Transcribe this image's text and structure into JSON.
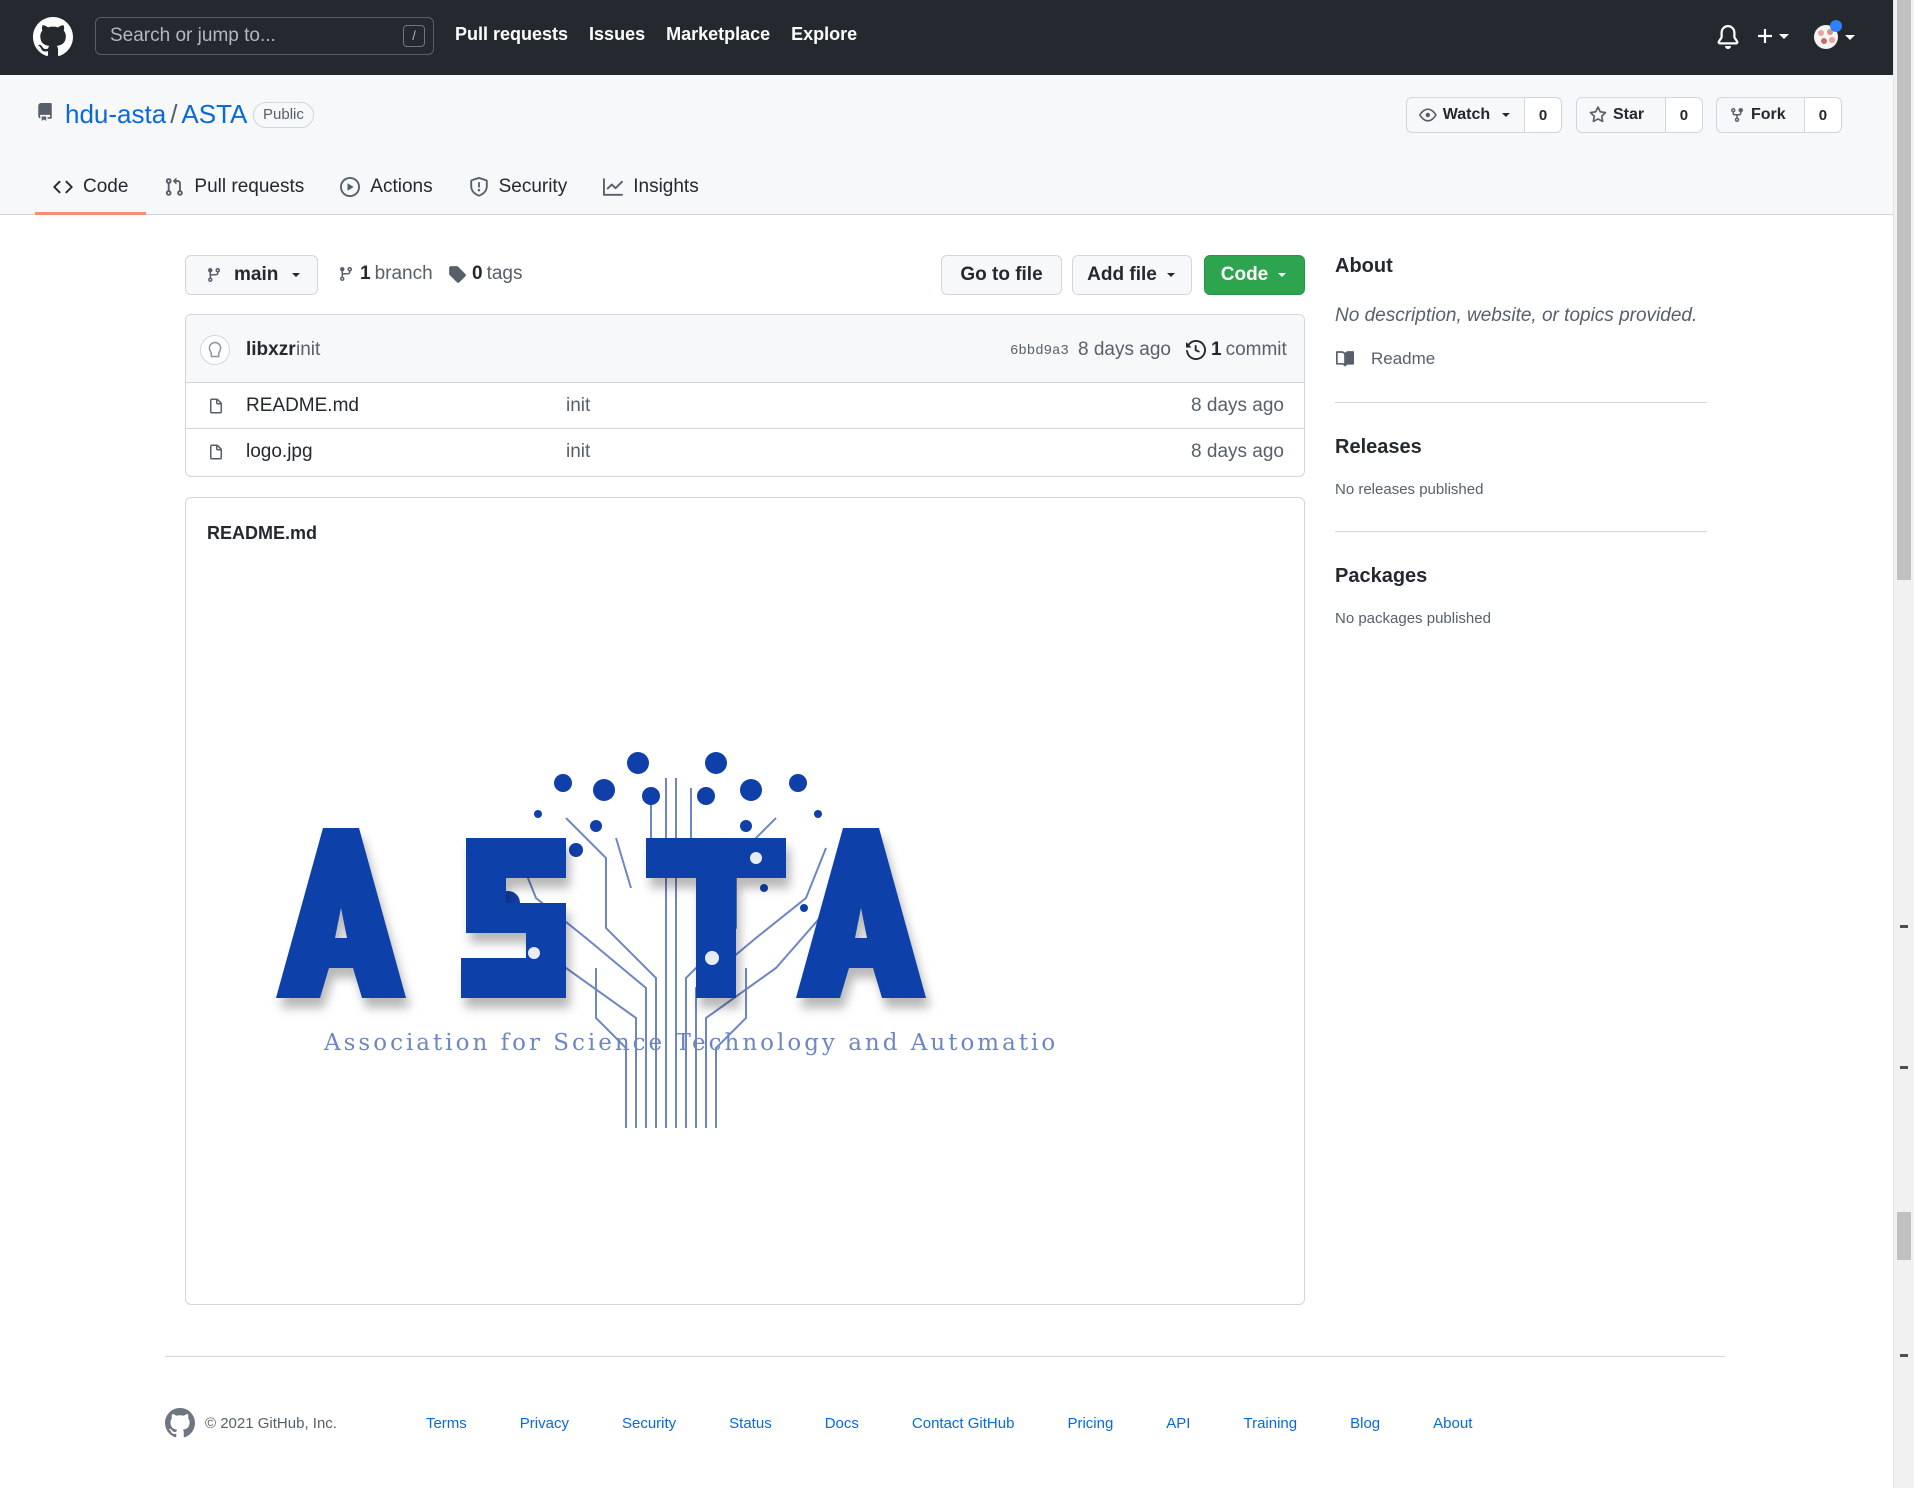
{
  "header": {
    "search_placeholder": "Search or jump to...",
    "search_shortcut": "/",
    "nav": [
      "Pull requests",
      "Issues",
      "Marketplace",
      "Explore"
    ],
    "icons": [
      "github-logo-icon",
      "bell-icon",
      "plus-icon",
      "avatar"
    ]
  },
  "repo": {
    "owner": "hdu-asta",
    "separator": "/",
    "name": "ASTA",
    "visibility": "Public",
    "watch": {
      "label": "Watch",
      "count": "0"
    },
    "star": {
      "label": "Star",
      "count": "0"
    },
    "fork": {
      "label": "Fork",
      "count": "0"
    }
  },
  "tabs": [
    {
      "label": "Code",
      "active": true
    },
    {
      "label": "Pull requests",
      "active": false
    },
    {
      "label": "Actions",
      "active": false
    },
    {
      "label": "Security",
      "active": false
    },
    {
      "label": "Insights",
      "active": false
    }
  ],
  "toolbar": {
    "branch": "main",
    "branch_count": "1",
    "branch_label": "branch",
    "tag_count": "0",
    "tag_label": "tags",
    "go_to_file": "Go to file",
    "add_file": "Add file",
    "code": "Code"
  },
  "commit": {
    "author": "libxzr",
    "message": "init",
    "sha": "6bbd9a3",
    "age": "8 days ago",
    "count": "1",
    "count_label": "commit"
  },
  "files": [
    {
      "name": "README.md",
      "message": "init",
      "age": "8 days ago"
    },
    {
      "name": "logo.jpg",
      "message": "init",
      "age": "8 days ago"
    }
  ],
  "readme": {
    "title": "README.md",
    "logo_text": "ASTA",
    "logo_subtitle": "Association for Science Technology and Automation"
  },
  "sidebar": {
    "about_title": "About",
    "about_desc": "No description, website, or topics provided.",
    "readme_link": "Readme",
    "releases_title": "Releases",
    "releases_note": "No releases published",
    "packages_title": "Packages",
    "packages_note": "No packages published"
  },
  "footer": {
    "copyright": "© 2021 GitHub, Inc.",
    "links": [
      "Terms",
      "Privacy",
      "Security",
      "Status",
      "Docs",
      "Contact GitHub",
      "Pricing",
      "API",
      "Training",
      "Blog",
      "About"
    ]
  },
  "colors": {
    "header_bg": "#24292f",
    "link": "#0969da",
    "green_button": "#2da44e",
    "active_tab": "#fd8c73",
    "logo_blue": "#0f3fa8"
  }
}
